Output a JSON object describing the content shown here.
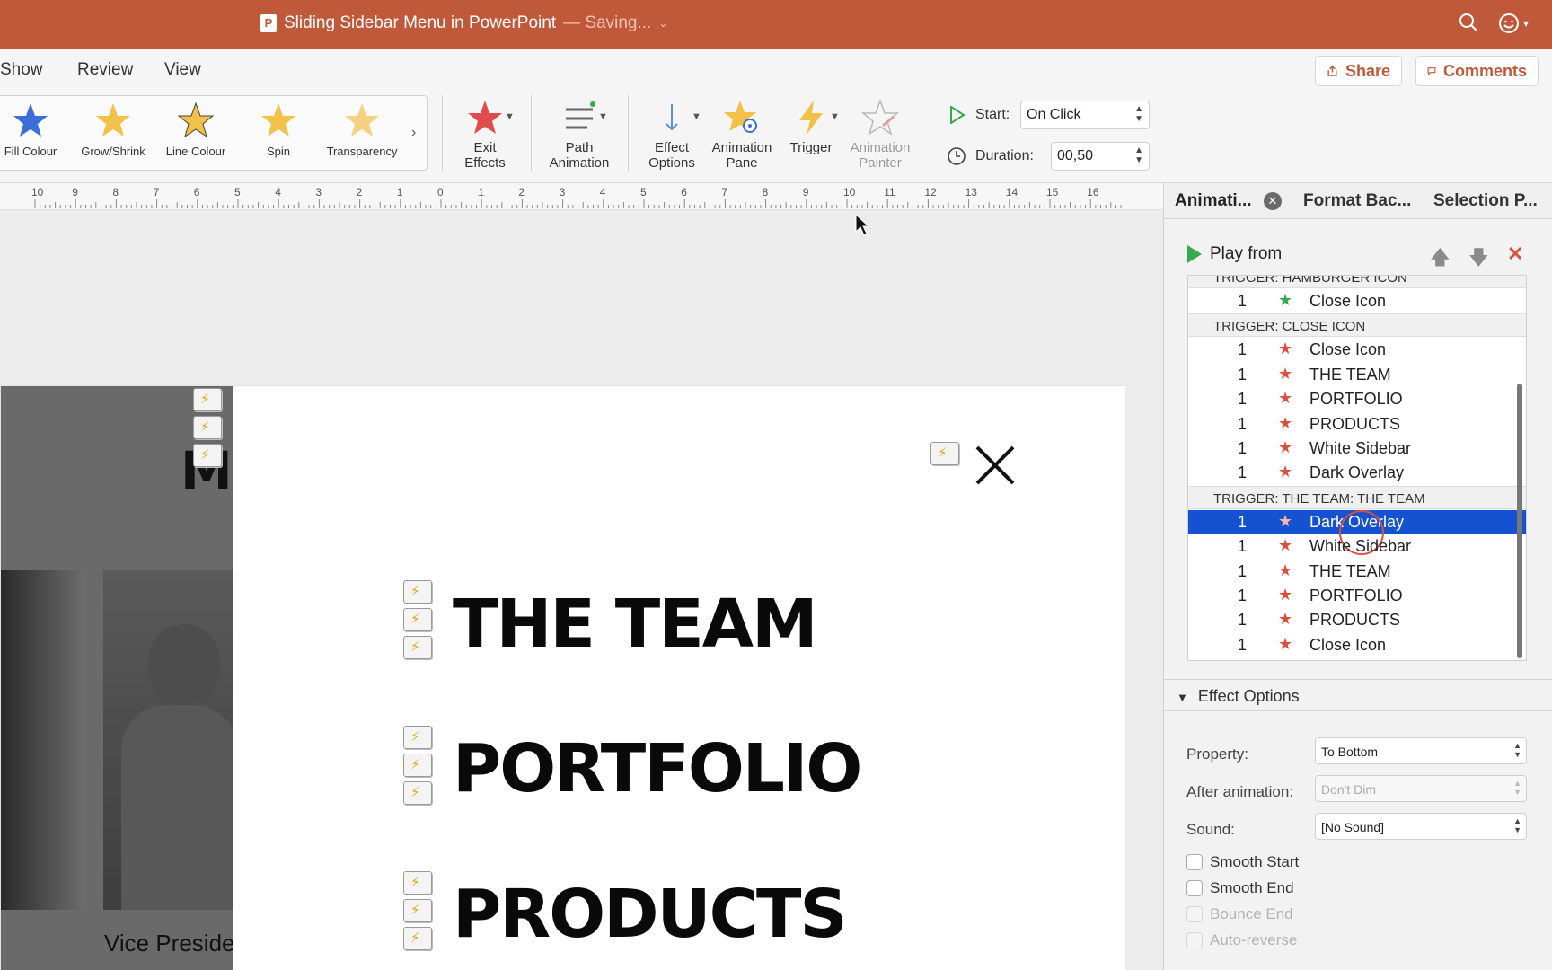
{
  "window": {
    "title": "Sliding Sidebar Menu in PowerPoint",
    "status": "— Saving...",
    "app_badge": "P"
  },
  "menu_tabs": [
    "Show",
    "Review",
    "View"
  ],
  "header_buttons": {
    "share": "Share",
    "comments": "Comments"
  },
  "ribbon": {
    "gallery": [
      "Fill Colour",
      "Grow/Shrink",
      "Line Colour",
      "Spin",
      "Transparency"
    ],
    "exit_effects": [
      "Exit",
      "Effects"
    ],
    "path_animation": [
      "Path",
      "Animation"
    ],
    "effect_options": [
      "Effect",
      "Options"
    ],
    "animation_pane": [
      "Animation",
      "Pane"
    ],
    "trigger": "Trigger",
    "animation_painter": [
      "Animation",
      "Painter"
    ],
    "start_label": "Start:",
    "start_value": "On Click",
    "duration_label": "Duration:",
    "duration_value": "00,50"
  },
  "ruler": {
    "labels": [
      "10",
      "9",
      "8",
      "7",
      "6",
      "5",
      "4",
      "3",
      "2",
      "1",
      "0",
      "1",
      "2",
      "3",
      "4",
      "5",
      "6",
      "7",
      "8",
      "9",
      "10",
      "11",
      "12",
      "13",
      "14",
      "15",
      "16"
    ]
  },
  "slide": {
    "menu_items": [
      "THE TEAM",
      "PORTFOLIO",
      "PRODUCTS"
    ],
    "partial_heading": "M",
    "caption": "Vice Preside"
  },
  "pane": {
    "tabs": [
      "Animati...",
      "Format Bac...",
      "Selection P..."
    ],
    "play_from": "Play from",
    "triggers": [
      {
        "label": "TRIGGER: HAMBURGER ICON",
        "rows": [
          {
            "num": "1",
            "name": "Close Icon",
            "kind": "entrance"
          }
        ]
      },
      {
        "label": "TRIGGER: CLOSE ICON",
        "rows": [
          {
            "num": "1",
            "name": "Close Icon",
            "kind": "exit"
          },
          {
            "num": "1",
            "name": "THE TEAM",
            "kind": "exit"
          },
          {
            "num": "1",
            "name": "PORTFOLIO",
            "kind": "exit"
          },
          {
            "num": "1",
            "name": "PRODUCTS",
            "kind": "exit"
          },
          {
            "num": "1",
            "name": "White Sidebar",
            "kind": "exit"
          },
          {
            "num": "1",
            "name": "Dark Overlay",
            "kind": "exit"
          }
        ]
      },
      {
        "label": "TRIGGER: THE TEAM: THE TEAM",
        "rows": [
          {
            "num": "1",
            "name": "Dark Overlay",
            "kind": "exit",
            "selected": true
          },
          {
            "num": "1",
            "name": "White Sidebar",
            "kind": "exit"
          },
          {
            "num": "1",
            "name": "THE TEAM",
            "kind": "exit"
          },
          {
            "num": "1",
            "name": "PORTFOLIO",
            "kind": "exit"
          },
          {
            "num": "1",
            "name": "PRODUCTS",
            "kind": "exit"
          },
          {
            "num": "1",
            "name": "Close Icon",
            "kind": "exit"
          }
        ]
      }
    ],
    "effect_options": {
      "header": "Effect Options",
      "property_label": "Property:",
      "property_value": "To Bottom",
      "after_label": "After animation:",
      "after_value": "Don't Dim",
      "sound_label": "Sound:",
      "sound_value": "[No Sound]",
      "checks": [
        {
          "label": "Smooth Start",
          "enabled": true
        },
        {
          "label": "Smooth End",
          "enabled": true
        },
        {
          "label": "Bounce End",
          "enabled": false
        },
        {
          "label": "Auto-reverse",
          "enabled": false
        }
      ]
    }
  },
  "colors": {
    "title_bar": "#c0583a",
    "selection": "#1552d2",
    "exit_star": "#d9503f",
    "entrance_star": "#3aa94d"
  }
}
